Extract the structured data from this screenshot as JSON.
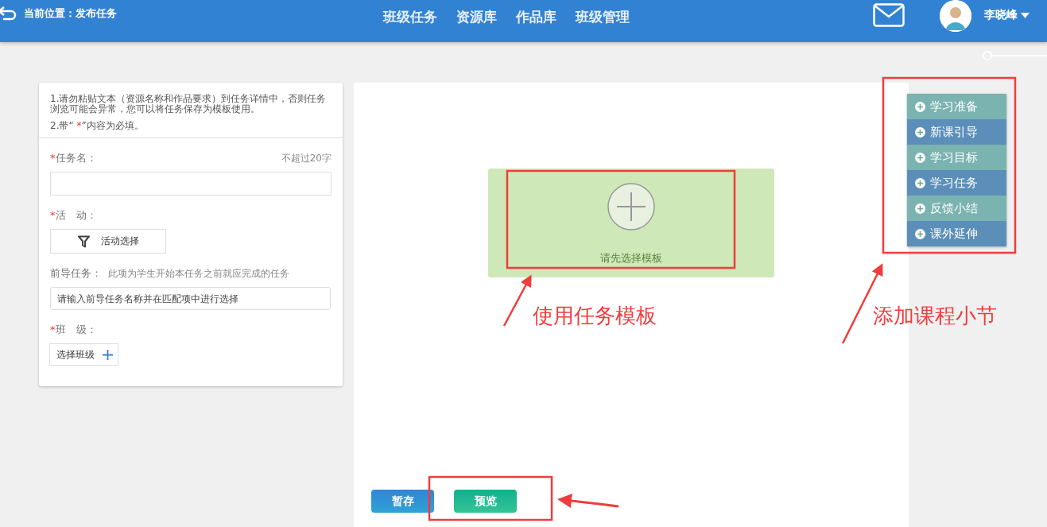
{
  "header": {
    "breadcrumb": "当前位置：发布任务",
    "nav": [
      {
        "label": "班级任务"
      },
      {
        "label": "资源库"
      },
      {
        "label": "作品库"
      },
      {
        "label": "班级管理"
      }
    ],
    "user": "李晓峰"
  },
  "notice": {
    "line_1": "1.请勿粘贴文本（资源名称和作品要求）到任务详情中，否则任务浏览可能会异常，您可以将任务保存为模板使用。",
    "line_2_before": "2.带“ ",
    "line_2_mark": "*",
    "line_2_after": "”内容为必填。"
  },
  "fields": [
    {
      "kind": "text",
      "required": true,
      "label": "任务名：",
      "hint": "不超过20字"
    },
    {
      "kind": "activity",
      "required": true,
      "label": "活　动：",
      "button": "活动选择"
    },
    {
      "kind": "search",
      "required": false,
      "label": "前导任务：",
      "hint": "此项为学生开始本任务之前就应完成的任务",
      "placeholder": "请输入前导任务名称并在匹配项中进行选择"
    },
    {
      "kind": "class",
      "required": true,
      "label": "班　级：",
      "button": "选择班级"
    }
  ],
  "template": {
    "label": "请先选择模板"
  },
  "buttons": [
    {
      "label": "暂存",
      "kind": "save"
    },
    {
      "label": "预览",
      "kind": "preview"
    }
  ],
  "sections": [
    {
      "label": "学习准备"
    },
    {
      "label": "新课引导"
    },
    {
      "label": "学习目标"
    },
    {
      "label": "学习任务"
    },
    {
      "label": "反馈小结"
    },
    {
      "label": "课外延伸"
    }
  ],
  "annotations": [
    {
      "text": "使用任务模板"
    },
    {
      "text": "添加课程小节"
    }
  ]
}
